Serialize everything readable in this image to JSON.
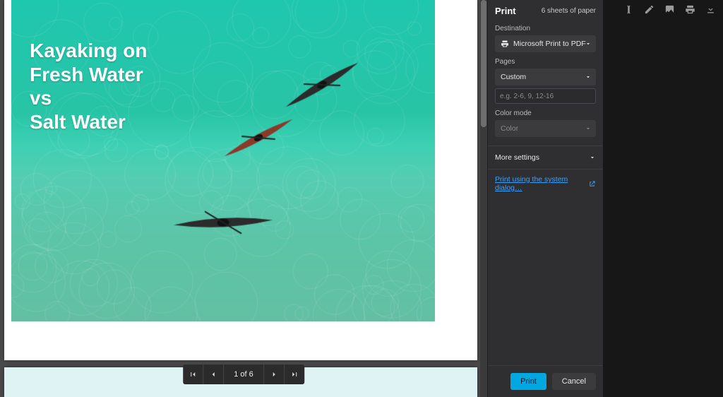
{
  "document": {
    "title_lines": [
      "Kayaking on",
      "Fresh Water",
      "vs",
      "Salt Water"
    ]
  },
  "pagination": {
    "current": 1,
    "total": 6,
    "label": "1 of 6"
  },
  "print_panel": {
    "title": "Print",
    "paper_count": "6 sheets of paper",
    "destination_label": "Destination",
    "destination_value": "Microsoft Print to PDF",
    "pages_label": "Pages",
    "pages_value": "Custom",
    "pages_input_placeholder": "e.g. 2-6, 9, 12-16",
    "pages_input_value": "",
    "color_label": "Color mode",
    "color_value": "Color",
    "more_settings_label": "More settings",
    "system_dialog_link": "Print using the system dialog…",
    "print_button": "Print",
    "cancel_button": "Cancel"
  },
  "icons": {
    "printer": "printer-icon",
    "chevron_down": "chevron-down-icon",
    "external": "external-link-icon",
    "first": "first-page-icon",
    "prev": "prev-page-icon",
    "next": "next-page-icon",
    "last": "last-page-icon",
    "cursor_text": "text-cursor-icon",
    "pencil": "pencil-icon",
    "image": "image-icon",
    "print_strip": "printer-icon",
    "download": "download-icon"
  },
  "colors": {
    "accent": "#00a7e1",
    "link": "#3aa0ff",
    "panel_bg": "#2f2e31",
    "dark_bg": "#171717"
  }
}
